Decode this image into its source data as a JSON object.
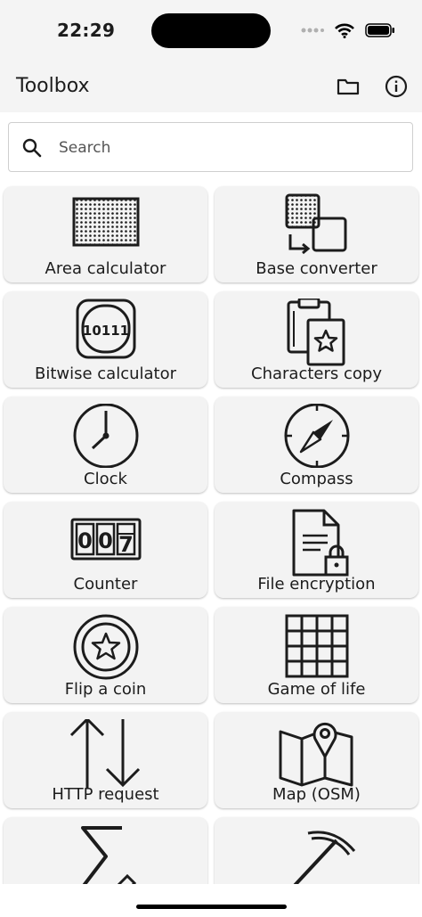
{
  "status": {
    "time": "22:29"
  },
  "app_bar": {
    "title": "Toolbox",
    "folder_icon": "folder-icon",
    "info_icon": "info-icon"
  },
  "search": {
    "placeholder": "Search",
    "value": ""
  },
  "tools": [
    {
      "label": "Area calculator",
      "icon": "area-grid-icon"
    },
    {
      "label": "Base converter",
      "icon": "base-converter-icon"
    },
    {
      "label": "Bitwise calculator",
      "icon": "bitwise-icon"
    },
    {
      "label": "Characters copy",
      "icon": "clipboard-star-icon"
    },
    {
      "label": "Clock",
      "icon": "clock-icon"
    },
    {
      "label": "Compass",
      "icon": "compass-icon"
    },
    {
      "label": "Counter",
      "icon": "counter-icon"
    },
    {
      "label": "File encryption",
      "icon": "file-lock-icon"
    },
    {
      "label": "Flip a coin",
      "icon": "coin-icon"
    },
    {
      "label": "Game of life",
      "icon": "grid-icon"
    },
    {
      "label": "HTTP request",
      "icon": "up-down-arrows-icon"
    },
    {
      "label": "Map (OSM)",
      "icon": "map-pin-icon"
    },
    {
      "label": "",
      "icon": "sigma-pencil-icon"
    },
    {
      "label": "",
      "icon": "pickaxe-icon"
    }
  ],
  "icon_text": {
    "bitwise": "10111",
    "counter": [
      "0",
      "0",
      "7"
    ]
  },
  "colors": {
    "bar_bg": "#f4f4f4",
    "tile_bg": "#f3f3f3",
    "ink": "#1c1c1c"
  }
}
